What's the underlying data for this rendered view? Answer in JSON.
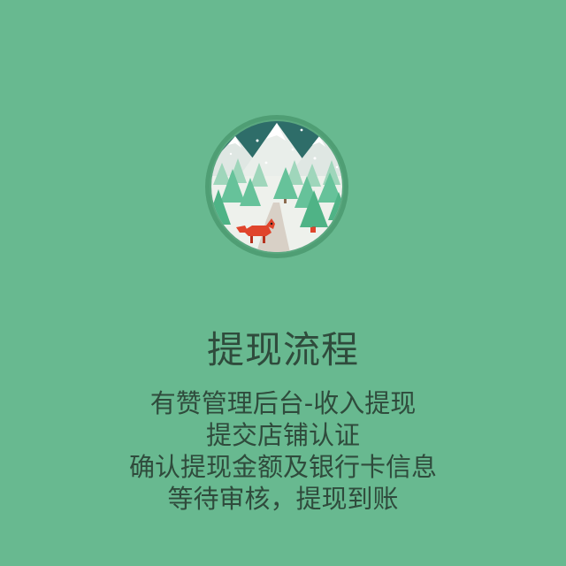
{
  "illustration": {
    "icon": "winter-forest-fox-icon",
    "colors": {
      "ring": "#4f9e74",
      "sky": "#2e6d69",
      "snow": "#eef1ec",
      "tree": "#66c29a",
      "fox": "#e0452c"
    }
  },
  "title": "提现流程",
  "steps": [
    "有赞管理后台-收入提现",
    "提交店铺认证",
    "确认提现金额及银行卡信息",
    "等待审核，提现到账"
  ]
}
